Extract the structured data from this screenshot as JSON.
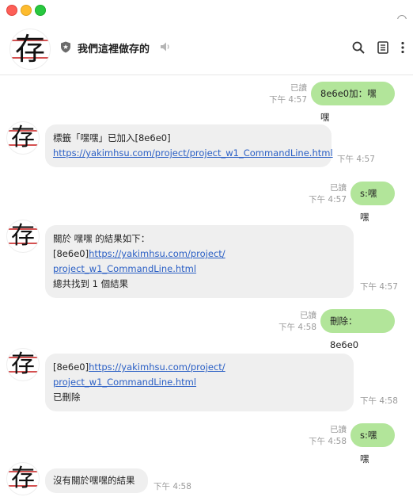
{
  "window": {
    "chat_title": "我們這裡做存的",
    "avatar_glyph": "存",
    "icons": [
      "shield-icon",
      "speaker-muted-icon",
      "search-icon",
      "notes-icon",
      "more-vertical-icon"
    ]
  },
  "messages": {
    "m1": {
      "text": "8e6e0加：嘿嘿",
      "read": "已讀",
      "time": "下午 4:57"
    },
    "m2": {
      "line1": "標籤「嘿嘿」已加入[8e6e0]",
      "link": "https://yakimhsu.com/project/project_w1_CommandLine.html",
      "time": "下午 4:57"
    },
    "m3": {
      "text": "s:嘿嘿",
      "read": "已讀",
      "time": "下午 4:57"
    },
    "m4": {
      "line1": "關於 嘿嘿 的結果如下：",
      "prefix": "[8e6e0]",
      "link_part1": "https://yakimhsu.com/project/",
      "link_part2": "project_w1_CommandLine.html",
      "line4": "總共找到 1 個結果",
      "time": "下午 4:57"
    },
    "m5": {
      "text": "刪除：8e6e0",
      "read": "已讀",
      "time": "下午 4:58"
    },
    "m6": {
      "prefix": "[8e6e0]",
      "link_part1": "https://yakimhsu.com/project/",
      "link_part2": "project_w1_CommandLine.html",
      "line3": "已刪除",
      "time": "下午 4:58"
    },
    "m7": {
      "text": "s:嘿嘿",
      "read": "已讀",
      "time": "下午 4:58"
    },
    "m8": {
      "text": "沒有關於嘿嘿的結果",
      "time": "下午 4:58"
    }
  },
  "colors": {
    "outgoing_bubble": "#b2e59a",
    "incoming_bubble": "#efefef",
    "link": "#2a5fc5"
  }
}
